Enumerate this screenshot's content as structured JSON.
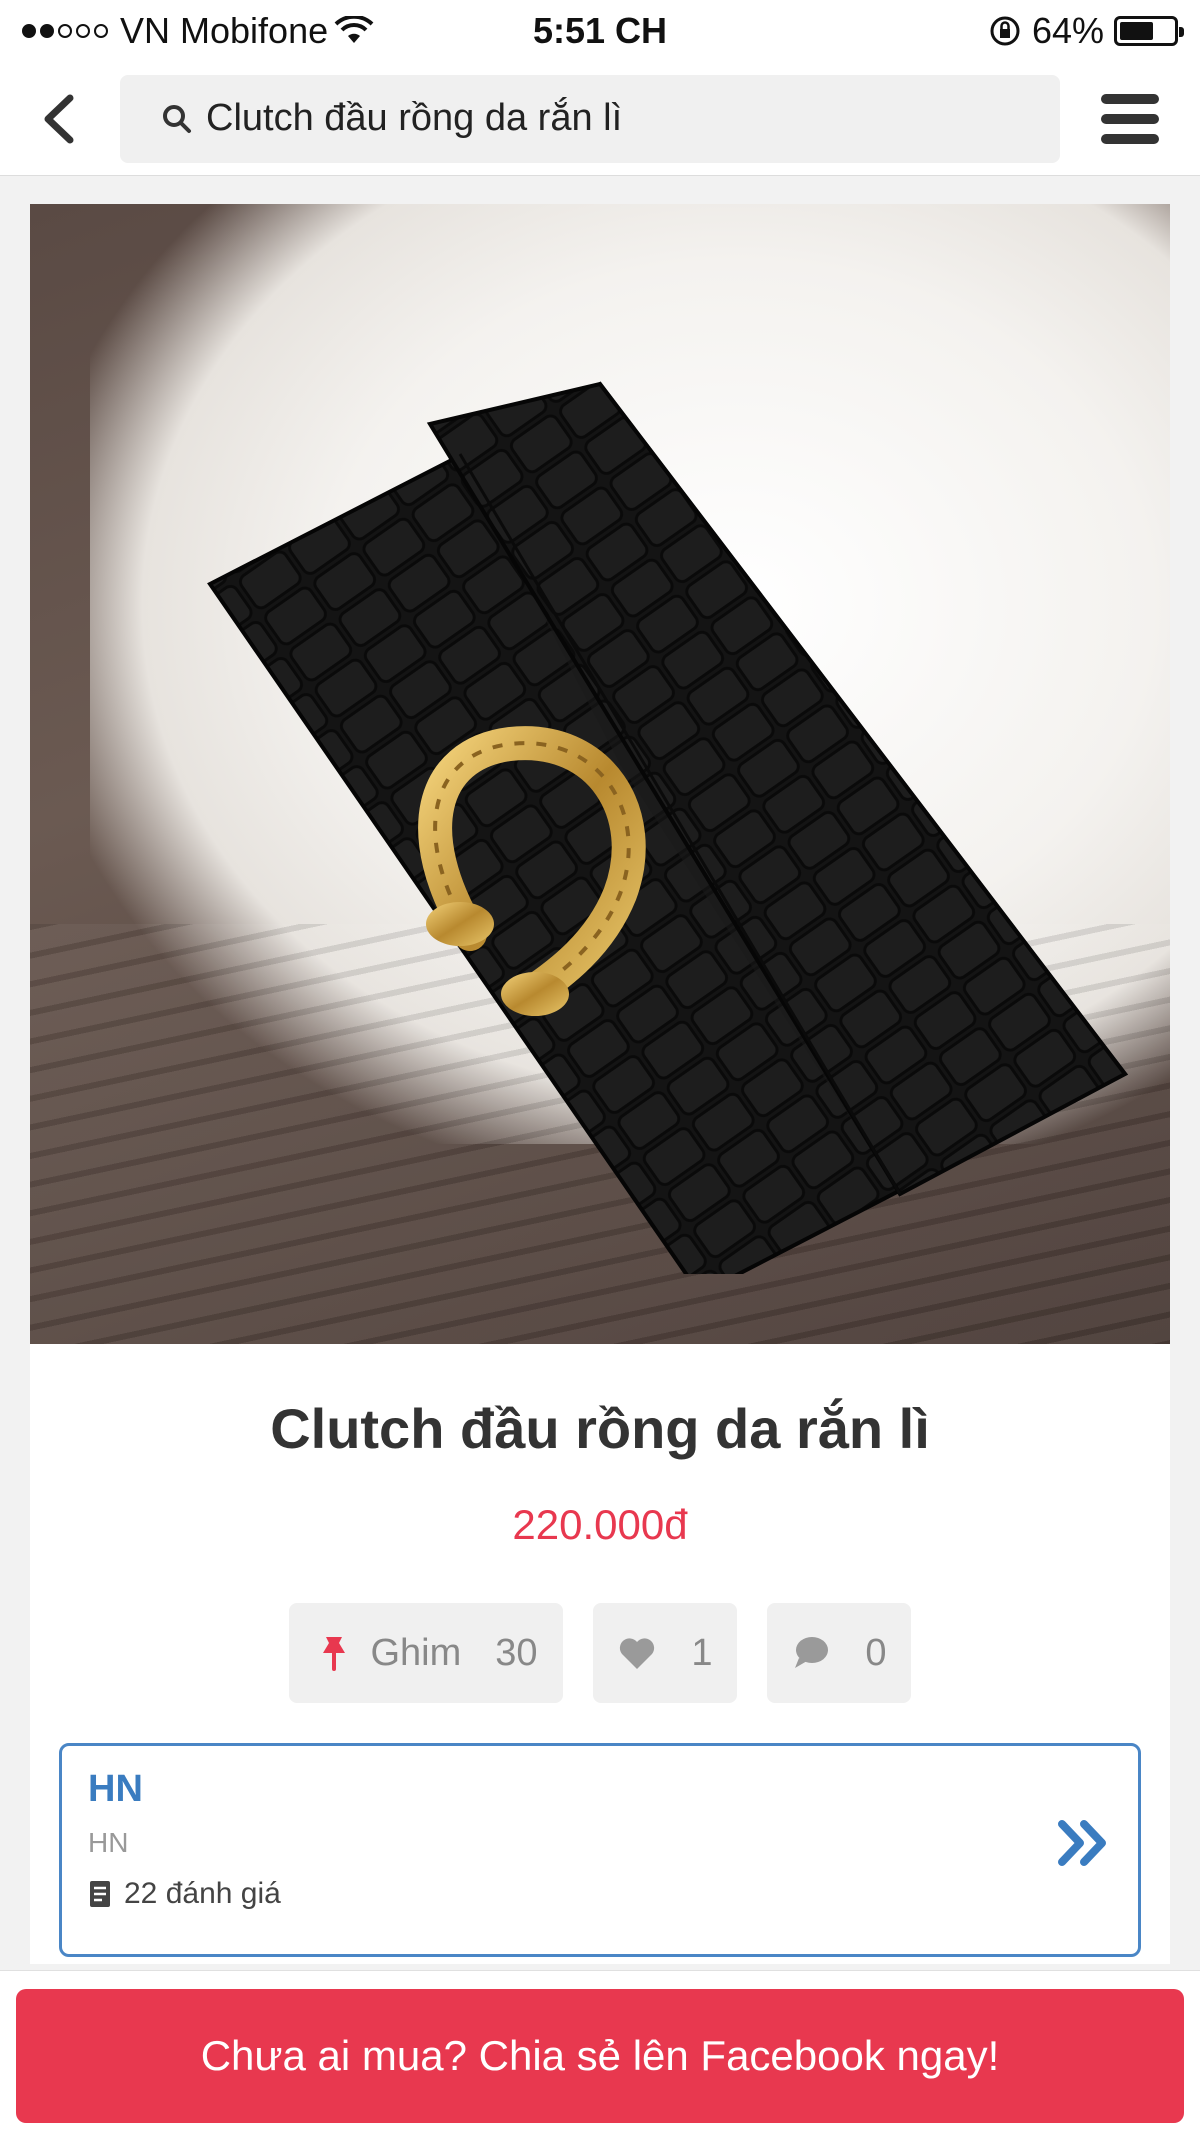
{
  "status_bar": {
    "carrier": "VN Mobifone",
    "time": "5:51 CH",
    "battery_percent": "64%",
    "battery_level": 0.64,
    "signal_bars_filled": 2,
    "signal_bars_total": 5
  },
  "nav": {
    "search_text": "Clutch đầu rồng da rắn lì"
  },
  "product": {
    "title": "Clutch đầu rồng da rắn lì",
    "price": "220.000đ"
  },
  "actions": {
    "pin_label": "Ghim",
    "pin_count": "30",
    "like_count": "1",
    "comment_count": "0"
  },
  "shop": {
    "name": "HN",
    "location": "HN",
    "reviews": "22 đánh giá"
  },
  "cta": {
    "label": "Chưa ai mua? Chia sẻ lên Facebook ngay!"
  },
  "colors": {
    "accent": "#e8384f",
    "link_blue": "#3a7cc0"
  }
}
